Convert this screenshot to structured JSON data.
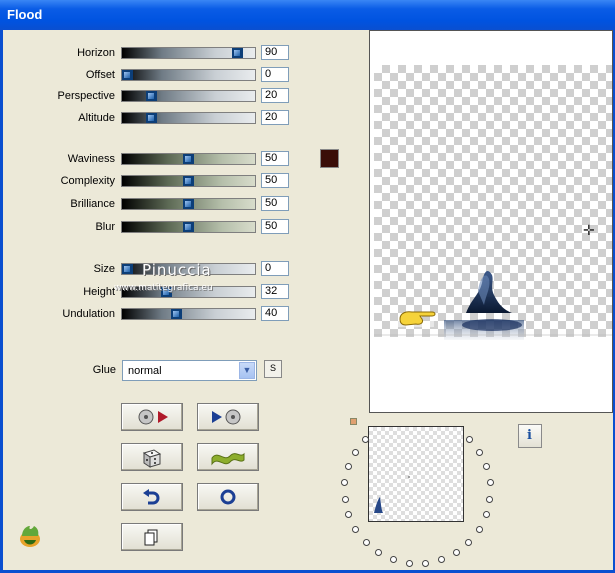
{
  "window": {
    "title": "Flood"
  },
  "controls": {
    "horizon": {
      "label": "Horizon",
      "value": "90",
      "level": 90
    },
    "offset": {
      "label": "Offset",
      "value": "0",
      "level": 0
    },
    "perspective": {
      "label": "Perspective",
      "value": "20",
      "level": 20
    },
    "altitude": {
      "label": "Altitude",
      "value": "20",
      "level": 20
    },
    "waviness": {
      "label": "Waviness",
      "value": "50",
      "level": 50
    },
    "complexity": {
      "label": "Complexity",
      "value": "50",
      "level": 50
    },
    "brilliance": {
      "label": "Brilliance",
      "value": "50",
      "level": 50
    },
    "blur": {
      "label": "Blur",
      "value": "50",
      "level": 50
    },
    "size": {
      "label": "Size",
      "value": "0",
      "level": 0
    },
    "height": {
      "label": "Height",
      "value": "32",
      "level": 32
    },
    "undulation": {
      "label": "Undulation",
      "value": "40",
      "level": 40
    }
  },
  "color_swatch": "#3a0d08",
  "watermark": {
    "line1": "Pinuccia",
    "line2": "www.matitegrafica.eu"
  },
  "glue": {
    "label": "Glue",
    "selected": "normal",
    "s_label": "S"
  },
  "buttons": [
    "load-preset-icon",
    "save-preset-icon",
    "randomize-icon",
    "wave-icon",
    "undo-icon",
    "reset-icon",
    "copy-icon"
  ],
  "info_label": "i"
}
